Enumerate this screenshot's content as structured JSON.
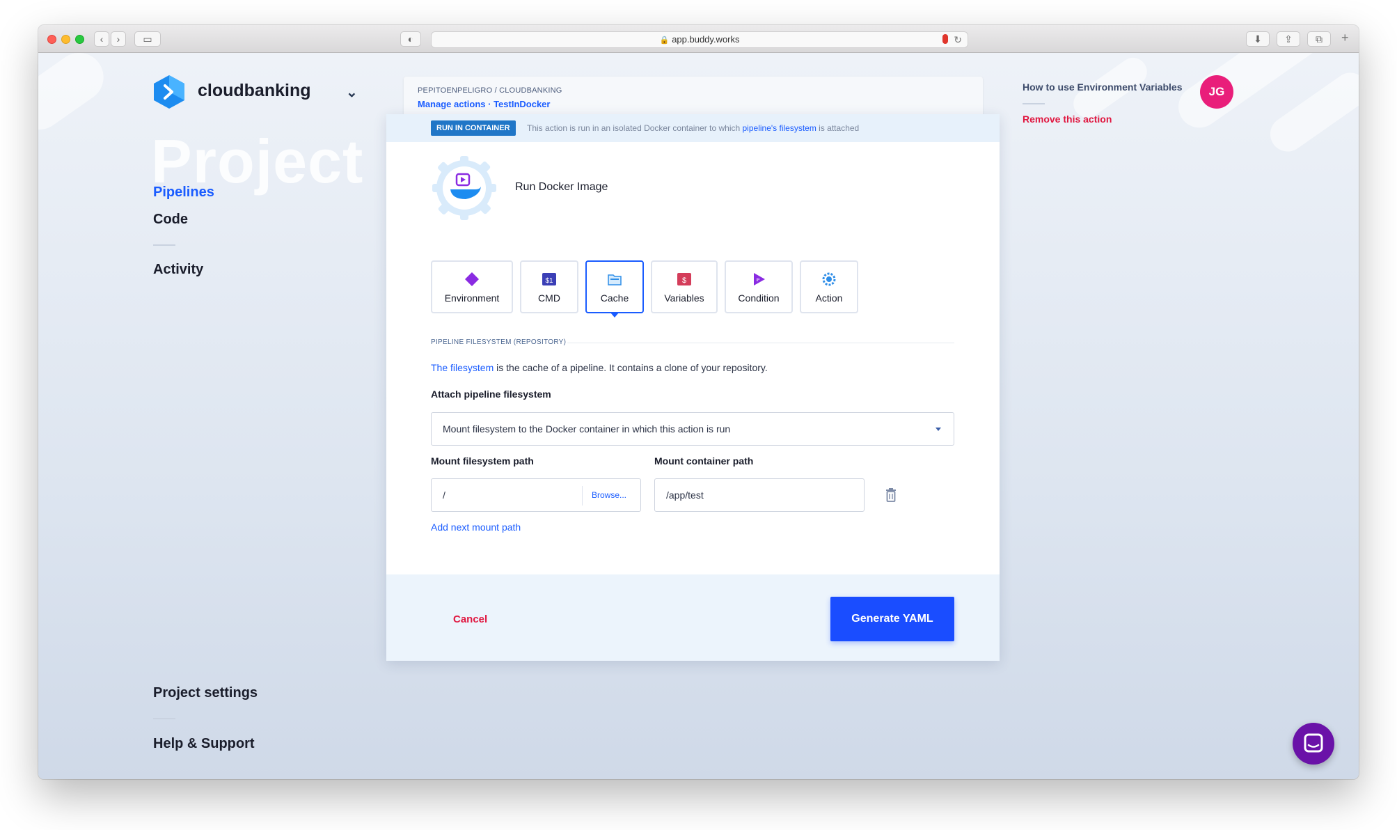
{
  "browser": {
    "url": "app.buddy.works"
  },
  "sidebar": {
    "brand": "cloudbanking",
    "bg_word": "Project",
    "items": [
      {
        "label": "Pipelines"
      },
      {
        "label": "Code"
      },
      {
        "label": "Activity"
      },
      {
        "label": "Project settings"
      },
      {
        "label": "Help & Support"
      }
    ]
  },
  "header": {
    "breadcrumb_top": "PEPITOENPELIGRO / CLOUDBANKING",
    "breadcrumb_links": "Manage actions · TestInDocker",
    "help_link": "How to use Environment Variables",
    "remove_link": "Remove this action",
    "avatar_initials": "JG"
  },
  "card": {
    "run_badge": "RUN IN CONTAINER",
    "run_text_before": "This action is run in an isolated Docker container to which ",
    "run_text_link": "pipeline's filesystem",
    "run_text_after": " is attached",
    "action_title": "Run Docker Image",
    "tabs": [
      {
        "label": "Environment",
        "icon": "diamond-icon"
      },
      {
        "label": "CMD",
        "icon": "terminal-icon"
      },
      {
        "label": "Cache",
        "icon": "folder-icon",
        "active": true
      },
      {
        "label": "Variables",
        "icon": "dollar-icon"
      },
      {
        "label": "Condition",
        "icon": "play-flag-icon"
      },
      {
        "label": "Action",
        "icon": "gear-icon"
      }
    ],
    "section_label": "PIPELINE FILESYSTEM (REPOSITORY)",
    "desc_link": "The filesystem",
    "desc_text": " is the cache of a pipeline. It contains a clone of your repository.",
    "attach_label": "Attach pipeline filesystem",
    "attach_value": "Mount filesystem to the Docker container in which this action is run",
    "mount_fs_label": "Mount filesystem path",
    "mount_fs_value": "/",
    "browse_label": "Browse...",
    "mount_container_label": "Mount container path",
    "mount_container_value": "/app/test",
    "add_path": "Add next mount path",
    "cancel": "Cancel",
    "generate": "Generate YAML"
  },
  "colors": {
    "accent": "#1a5cff",
    "danger": "#e0163f",
    "avatar": "#e91e7a",
    "chat": "#6a12a8"
  }
}
